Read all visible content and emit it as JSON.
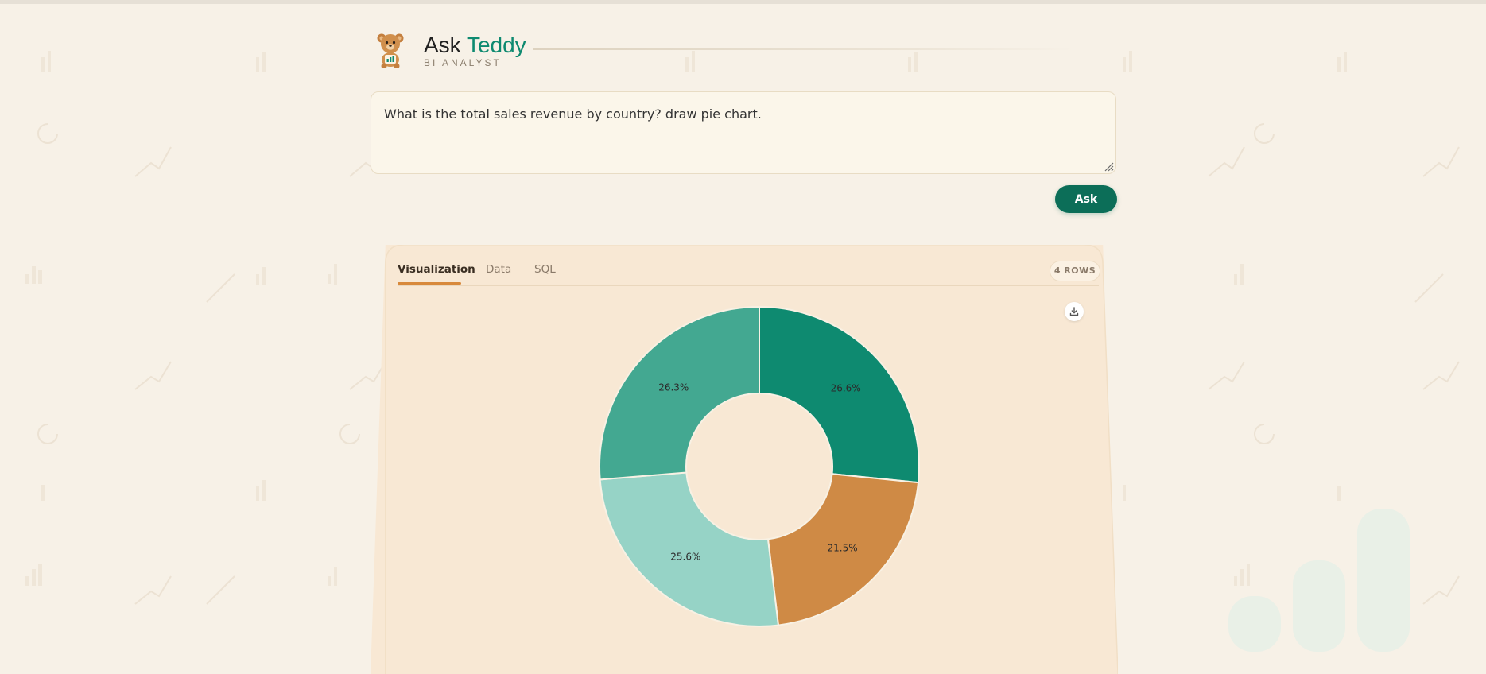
{
  "app": {
    "title_prefix": "Ask",
    "title_accent": "Teddy",
    "subtitle": "BI ANALYST"
  },
  "query": {
    "text": "What is the total sales revenue by country? draw pie chart."
  },
  "ask_button": {
    "label": "Ask"
  },
  "tabs": [
    {
      "label": "Visualization",
      "active": true
    },
    {
      "label": "Data",
      "active": false
    },
    {
      "label": "SQL",
      "active": false
    }
  ],
  "rows_badge": "4 ROWS",
  "icons": {
    "logo": "teddy-bear-icon",
    "download": "download-icon"
  },
  "colors": {
    "accent": "#0e8a70",
    "button": "#0c6e58",
    "tab_underline": "#d8893b"
  },
  "chart_data": {
    "type": "pie",
    "donut": true,
    "values": [
      26.6,
      21.5,
      25.6,
      26.3
    ],
    "labels": [
      "26.6%",
      "21.5%",
      "25.6%",
      "26.3%"
    ],
    "colors": [
      "#0e8a70",
      "#cf8a45",
      "#96d3c6",
      "#43a891"
    ]
  }
}
